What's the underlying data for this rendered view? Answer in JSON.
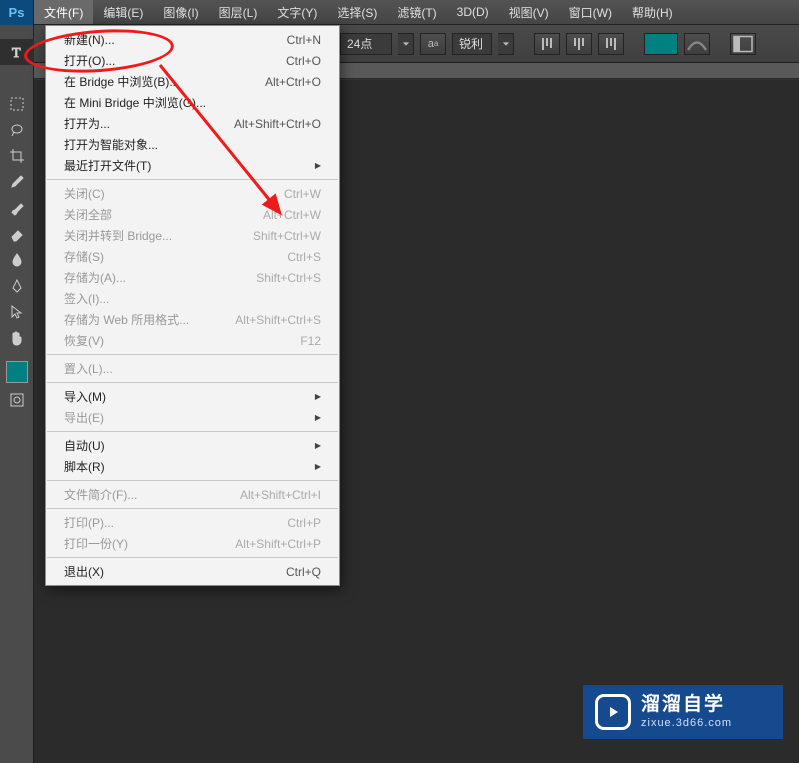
{
  "app": {
    "logo": "Ps"
  },
  "menubar": [
    "文件(F)",
    "编辑(E)",
    "图像(I)",
    "图层(L)",
    "文字(Y)",
    "选择(S)",
    "滤镜(T)",
    "3D(D)",
    "视图(V)",
    "窗口(W)",
    "帮助(H)"
  ],
  "optionbar": {
    "font_size": "24点",
    "aa_label": "锐利"
  },
  "dropdown": {
    "groups": [
      [
        {
          "label": "新建(N)...",
          "shortcut": "Ctrl+N"
        },
        {
          "label": "打开(O)...",
          "shortcut": "Ctrl+O",
          "highlight": true
        },
        {
          "label": "在 Bridge 中浏览(B)...",
          "shortcut": "Alt+Ctrl+O"
        },
        {
          "label": "在 Mini Bridge 中浏览(G)..."
        },
        {
          "label": "打开为...",
          "shortcut": "Alt+Shift+Ctrl+O"
        },
        {
          "label": "打开为智能对象..."
        },
        {
          "label": "最近打开文件(T)",
          "submenu": true
        }
      ],
      [
        {
          "label": "关闭(C)",
          "shortcut": "Ctrl+W",
          "disabled": true
        },
        {
          "label": "关闭全部",
          "shortcut": "Alt+Ctrl+W",
          "disabled": true
        },
        {
          "label": "关闭并转到 Bridge...",
          "shortcut": "Shift+Ctrl+W",
          "disabled": true
        },
        {
          "label": "存储(S)",
          "shortcut": "Ctrl+S",
          "disabled": true
        },
        {
          "label": "存储为(A)...",
          "shortcut": "Shift+Ctrl+S",
          "disabled": true
        },
        {
          "label": "签入(I)...",
          "disabled": true
        },
        {
          "label": "存储为 Web 所用格式...",
          "shortcut": "Alt+Shift+Ctrl+S",
          "disabled": true
        },
        {
          "label": "恢复(V)",
          "shortcut": "F12",
          "disabled": true
        }
      ],
      [
        {
          "label": "置入(L)...",
          "disabled": true
        }
      ],
      [
        {
          "label": "导入(M)",
          "submenu": true
        },
        {
          "label": "导出(E)",
          "submenu": true,
          "disabled": true
        }
      ],
      [
        {
          "label": "自动(U)",
          "submenu": true
        },
        {
          "label": "脚本(R)",
          "submenu": true
        }
      ],
      [
        {
          "label": "文件简介(F)...",
          "shortcut": "Alt+Shift+Ctrl+I",
          "disabled": true
        }
      ],
      [
        {
          "label": "打印(P)...",
          "shortcut": "Ctrl+P",
          "disabled": true
        },
        {
          "label": "打印一份(Y)",
          "shortcut": "Alt+Shift+Ctrl+P",
          "disabled": true
        }
      ],
      [
        {
          "label": "退出(X)",
          "shortcut": "Ctrl+Q"
        }
      ]
    ]
  },
  "watermark": {
    "title": "溜溜自学",
    "sub": "zixue.3d66.com"
  },
  "colors": {
    "accent": "#008080",
    "brand": "#164a8f",
    "highlight": "#ef1a1a"
  }
}
